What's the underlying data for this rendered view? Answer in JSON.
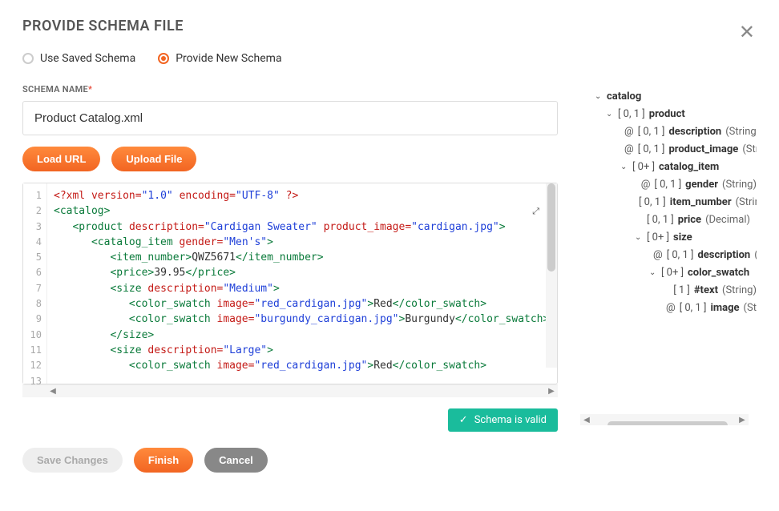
{
  "title": "PROVIDE SCHEMA FILE",
  "radios": {
    "saved": "Use Saved Schema",
    "new": "Provide New Schema"
  },
  "schema_label": "SCHEMA NAME",
  "schema_value": "Product Catalog.xml",
  "btn_load": "Load URL",
  "btn_upload": "Upload File",
  "code_lines": [
    {
      "n": "1",
      "html": "<span class='decl'>&lt;?xml</span> <span class='attr'>version=</span><span class='val'>\"1.0\"</span> <span class='attr'>encoding=</span><span class='val'>\"UTF-8\"</span> <span class='decl'>?&gt;</span>"
    },
    {
      "n": "2",
      "html": "<span class='tag'>&lt;catalog&gt;</span>"
    },
    {
      "n": "3",
      "html": "   <span class='tag'>&lt;product</span> <span class='attr'>description=</span><span class='val'>\"Cardigan Sweater\"</span> <span class='attr'>product_image=</span><span class='val'>\"cardigan.jpg\"</span><span class='tag'>&gt;</span>"
    },
    {
      "n": "4",
      "html": "      <span class='tag'>&lt;catalog_item</span> <span class='attr'>gender=</span><span class='val'>\"Men's\"</span><span class='tag'>&gt;</span>"
    },
    {
      "n": "5",
      "html": "         <span class='tag'>&lt;item_number&gt;</span><span class='txt'>QWZ5671</span><span class='tag'>&lt;/item_number&gt;</span>"
    },
    {
      "n": "6",
      "html": "         <span class='tag'>&lt;price&gt;</span><span class='txt'>39.95</span><span class='tag'>&lt;/price&gt;</span>"
    },
    {
      "n": "7",
      "html": "         <span class='tag'>&lt;size</span> <span class='attr'>description=</span><span class='val'>\"Medium\"</span><span class='tag'>&gt;</span>"
    },
    {
      "n": "8",
      "html": "            <span class='tag'>&lt;color_swatch</span> <span class='attr'>image=</span><span class='val'>\"red_cardigan.jpg\"</span><span class='tag'>&gt;</span><span class='txt'>Red</span><span class='tag'>&lt;/color_swatch&gt;</span>"
    },
    {
      "n": "9",
      "html": "            <span class='tag'>&lt;color_swatch</span> <span class='attr'>image=</span><span class='val'>\"burgundy_cardigan.jpg\"</span><span class='tag'>&gt;</span><span class='txt'>Burgundy</span><span class='tag'>&lt;/color_swatch&gt;</span>"
    },
    {
      "n": "10",
      "html": "         <span class='tag'>&lt;/size&gt;</span>"
    },
    {
      "n": "11",
      "html": "         <span class='tag'>&lt;size</span> <span class='attr'>description=</span><span class='val'>\"Large\"</span><span class='tag'>&gt;</span>"
    },
    {
      "n": "12",
      "html": "            <span class='tag'>&lt;color_swatch</span> <span class='attr'>image=</span><span class='val'>\"red_cardigan.jpg\"</span><span class='tag'>&gt;</span><span class='txt'>Red</span><span class='tag'>&lt;/color_swatch&gt;</span>"
    },
    {
      "n": "13",
      "html": ""
    }
  ],
  "valid": "Schema is valid",
  "btn_save": "Save Changes",
  "btn_finish": "Finish",
  "btn_cancel": "Cancel",
  "tree": [
    {
      "ind": 0,
      "chev": "v",
      "at": "",
      "card": "",
      "name": "catalog",
      "type": ""
    },
    {
      "ind": 1,
      "chev": "v",
      "at": "",
      "card": "[ 0, 1 ]",
      "name": "product",
      "type": ""
    },
    {
      "ind": 2,
      "chev": "",
      "at": "@",
      "card": "[ 0, 1 ]",
      "name": "description",
      "type": "(String)"
    },
    {
      "ind": 2,
      "chev": "",
      "at": "@",
      "card": "[ 0, 1 ]",
      "name": "product_image",
      "type": "(String)"
    },
    {
      "ind": 3,
      "chev": "v",
      "at": "",
      "card": "[ 0+ ]",
      "name": "catalog_item",
      "type": ""
    },
    {
      "ind": 4,
      "chev": "",
      "at": "@",
      "card": "[ 0, 1 ]",
      "name": "gender",
      "type": "(String)"
    },
    {
      "ind": 4,
      "chev": "",
      "at": "",
      "card": "[ 0, 1 ]",
      "name": "item_number",
      "type": "(String)"
    },
    {
      "ind": 4,
      "chev": "",
      "at": "",
      "card": "[ 0, 1 ]",
      "name": "price",
      "type": "(Decimal)"
    },
    {
      "ind": 5,
      "chev": "v",
      "at": "",
      "card": "[ 0+ ]",
      "name": "size",
      "type": ""
    },
    {
      "ind": 6,
      "chev": "",
      "at": "@",
      "card": "[ 0, 1 ]",
      "name": "description",
      "type": "(String)"
    },
    {
      "ind": 7,
      "chev": "v",
      "at": "",
      "card": "[ 0+ ]",
      "name": "color_swatch",
      "type": ""
    },
    {
      "ind": 6,
      "chev": "",
      "at": "",
      "card": "[ 1 ]",
      "name": "#text",
      "type": "(String)",
      "extra": 16
    },
    {
      "ind": 6,
      "chev": "",
      "at": "@",
      "card": "[ 0, 1 ]",
      "name": "image",
      "type": "(String)",
      "extra": 16
    }
  ]
}
